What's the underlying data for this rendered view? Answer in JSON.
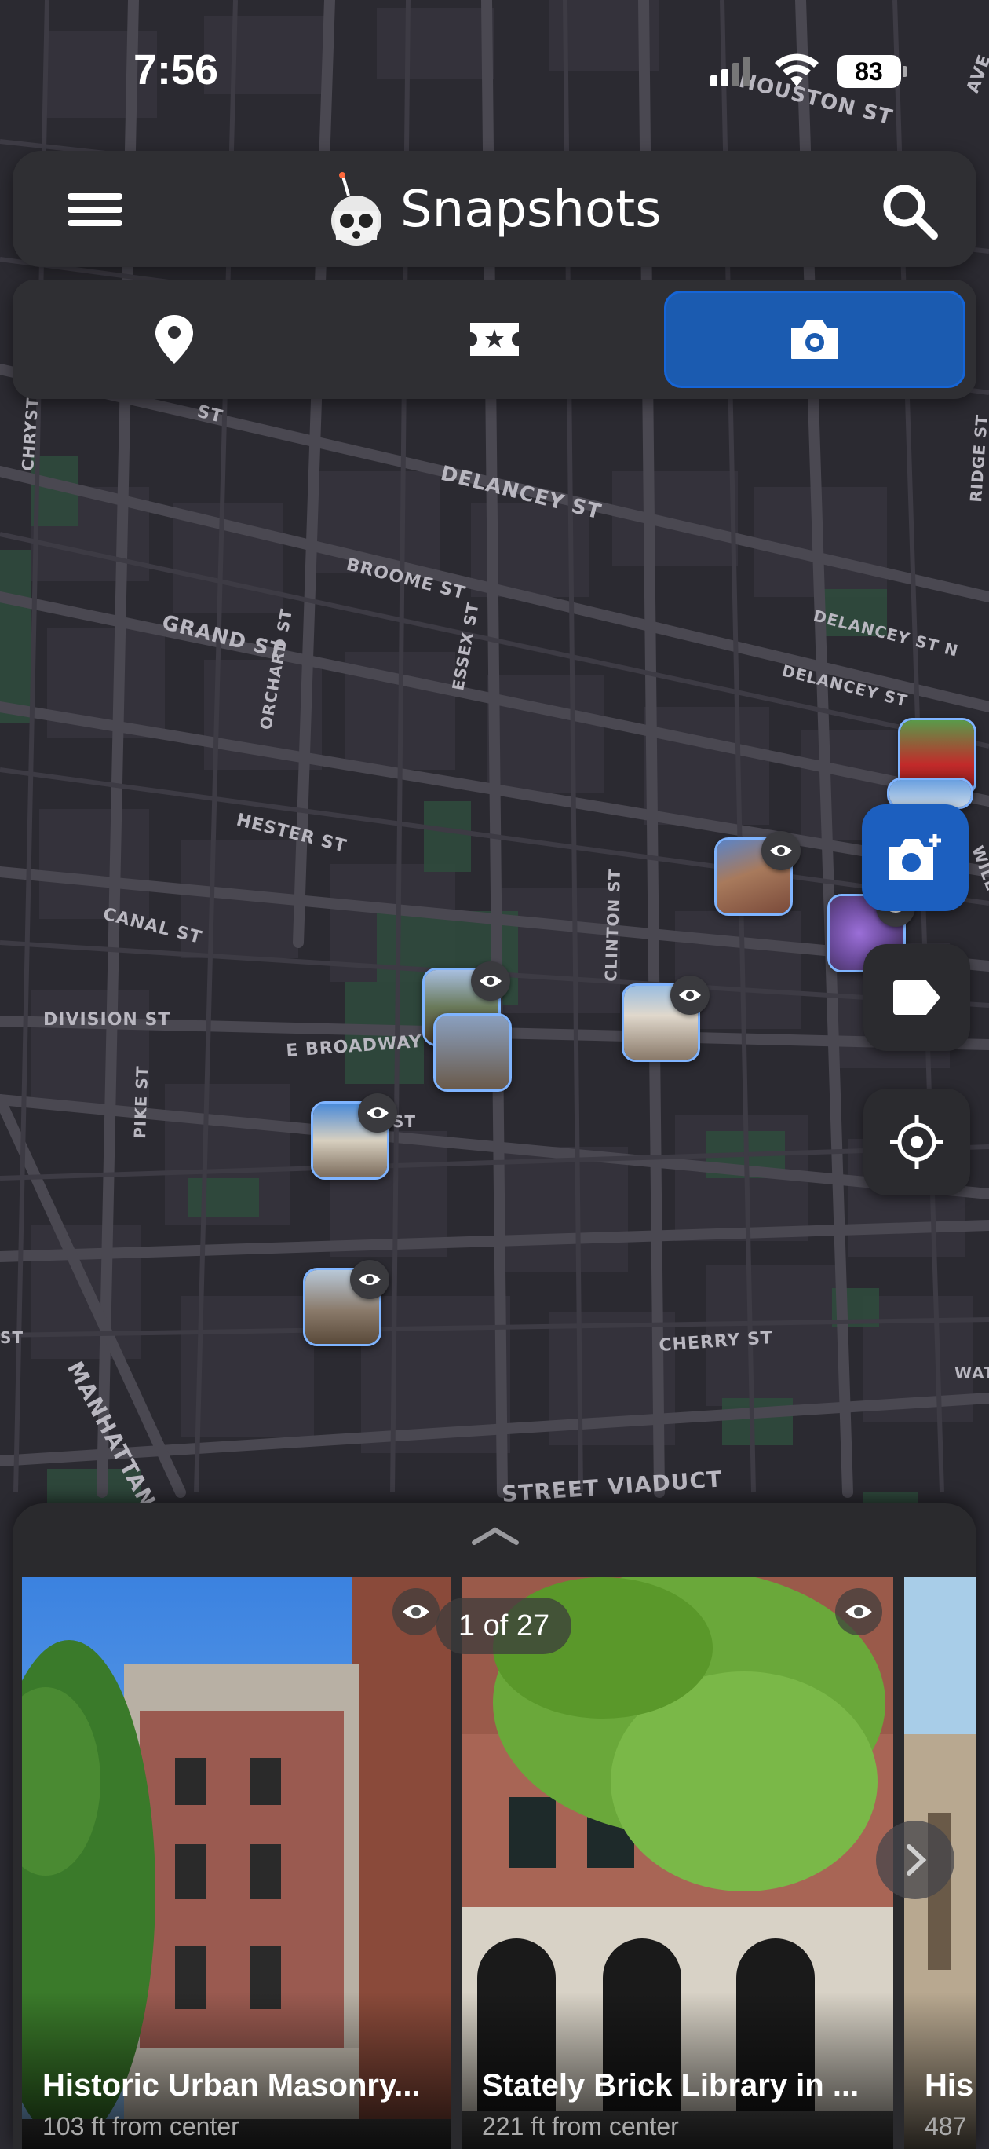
{
  "status_bar": {
    "time": "7:56",
    "battery": "83"
  },
  "header": {
    "title": "Snapshots",
    "menu_icon": "hamburger-menu-icon",
    "search_icon": "search-icon",
    "logo_icon": "robot-mascot-icon"
  },
  "tabs": [
    {
      "icon": "location-pin-icon",
      "active": false
    },
    {
      "icon": "ticket-star-icon",
      "active": false
    },
    {
      "icon": "camera-icon",
      "active": true
    }
  ],
  "map": {
    "street_labels": [
      "HOUSTON ST",
      "DELANCEY ST",
      "BROOME ST",
      "GRAND ST",
      "ORCHARD ST",
      "ESSEX ST",
      "DELANCEY ST N",
      "DELANCEY ST",
      "HESTER ST",
      "CANAL ST",
      "DIVISION ST",
      "E BROADWAY",
      "PIKE ST",
      "CLINTON ST",
      "CHERRY ST",
      "MANHATTAN",
      "STREET VIADUCT",
      "CHRYSTIE ST",
      "RIDGE ST",
      "AVE",
      "ST",
      "ST",
      "ST",
      "WILL",
      "WAT"
    ]
  },
  "fabs": {
    "add_photo_icon": "camera-plus-icon",
    "tag_icon": "tag-icon",
    "locate_icon": "crosshair-icon"
  },
  "sheet": {
    "counter": "1 of 27",
    "cards": [
      {
        "title": "Historic Urban Masonry...",
        "distance": "103 ft from center"
      },
      {
        "title": "Stately Brick Library in ...",
        "distance": "221 ft from center"
      },
      {
        "title": "His",
        "distance": "487"
      }
    ]
  },
  "colors": {
    "accent": "#1b5bb0",
    "background": "#2b2a30",
    "pin_border": "#7fb4ff"
  }
}
